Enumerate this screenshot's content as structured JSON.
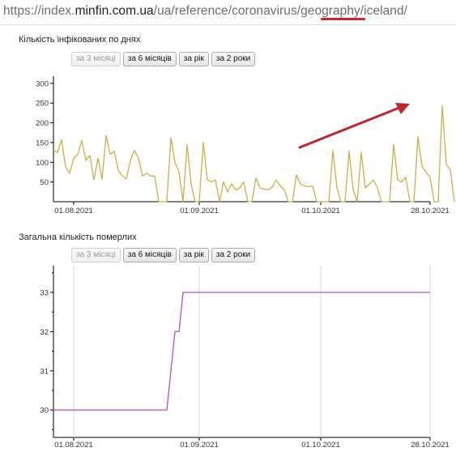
{
  "browser": {
    "url_prefix": "https://index.",
    "url_host": "minfin.com.ua",
    "url_path": "/ua/reference/coronavirus/geography/",
    "url_highlight": "iceland/"
  },
  "colors": {
    "infected_line": "#c8b14a",
    "deaths_line": "#b256b0",
    "annotation_arrow": "#c0272d",
    "highlight_underline": "#d2262c"
  },
  "periods": [
    {
      "label": "за 3 місяці",
      "disabled": true
    },
    {
      "label": "за 6 місяців",
      "disabled": false
    },
    {
      "label": "за рік",
      "disabled": false
    },
    {
      "label": "за 2 роки",
      "disabled": false
    }
  ],
  "chart_data": [
    {
      "type": "line",
      "title": "Кількість інфікованих по днях",
      "x_tick_labels": [
        "01.08.2021",
        "01.09.2021",
        "01.10.2021",
        "28.10.2021"
      ],
      "y_ticks": [
        50,
        100,
        150,
        200,
        250,
        300
      ],
      "ylim": [
        0,
        310
      ],
      "x_start": "2021-07-27",
      "x_end": "2021-10-28",
      "series": [
        {
          "color": "#c8b14a",
          "values": [
            130,
            125,
            157,
            88,
            72,
            110,
            120,
            155,
            105,
            117,
            55,
            110,
            57,
            168,
            120,
            128,
            80,
            65,
            58,
            105,
            130,
            110,
            65,
            72,
            65,
            65,
            0,
            0,
            0,
            162,
            100,
            75,
            0,
            145,
            45,
            0,
            0,
            150,
            55,
            50,
            55,
            0,
            50,
            25,
            45,
            30,
            35,
            50,
            0,
            0,
            60,
            35,
            32,
            30,
            37,
            55,
            40,
            30,
            0,
            0,
            68,
            45,
            40,
            38,
            40,
            0,
            0,
            0,
            0,
            130,
            35,
            0,
            0,
            128,
            30,
            0,
            125,
            35,
            45,
            55,
            35,
            0,
            0,
            0,
            145,
            55,
            50,
            62,
            0,
            0,
            165,
            90,
            75,
            62,
            0,
            0,
            243,
            95,
            80,
            0
          ]
        }
      ],
      "annotation": "arrow"
    },
    {
      "type": "line",
      "title": "Загальна кількість померлих",
      "x_tick_labels": [
        "01.08.2021",
        "01.09.2021",
        "01.10.2021",
        "28.10.2021"
      ],
      "y_ticks": [
        30,
        31,
        32,
        33
      ],
      "ylim": [
        29.3,
        33.6
      ],
      "x_start": "2021-07-27",
      "x_end": "2021-10-28",
      "series": [
        {
          "color": "#b256b0",
          "values_step": [
            {
              "date": "2021-07-27",
              "value": 30
            },
            {
              "date": "2021-08-24",
              "value": 30
            },
            {
              "date": "2021-08-26",
              "value": 32
            },
            {
              "date": "2021-08-27",
              "value": 32
            },
            {
              "date": "2021-08-28",
              "value": 33
            },
            {
              "date": "2021-10-28",
              "value": 33
            }
          ]
        }
      ]
    }
  ]
}
